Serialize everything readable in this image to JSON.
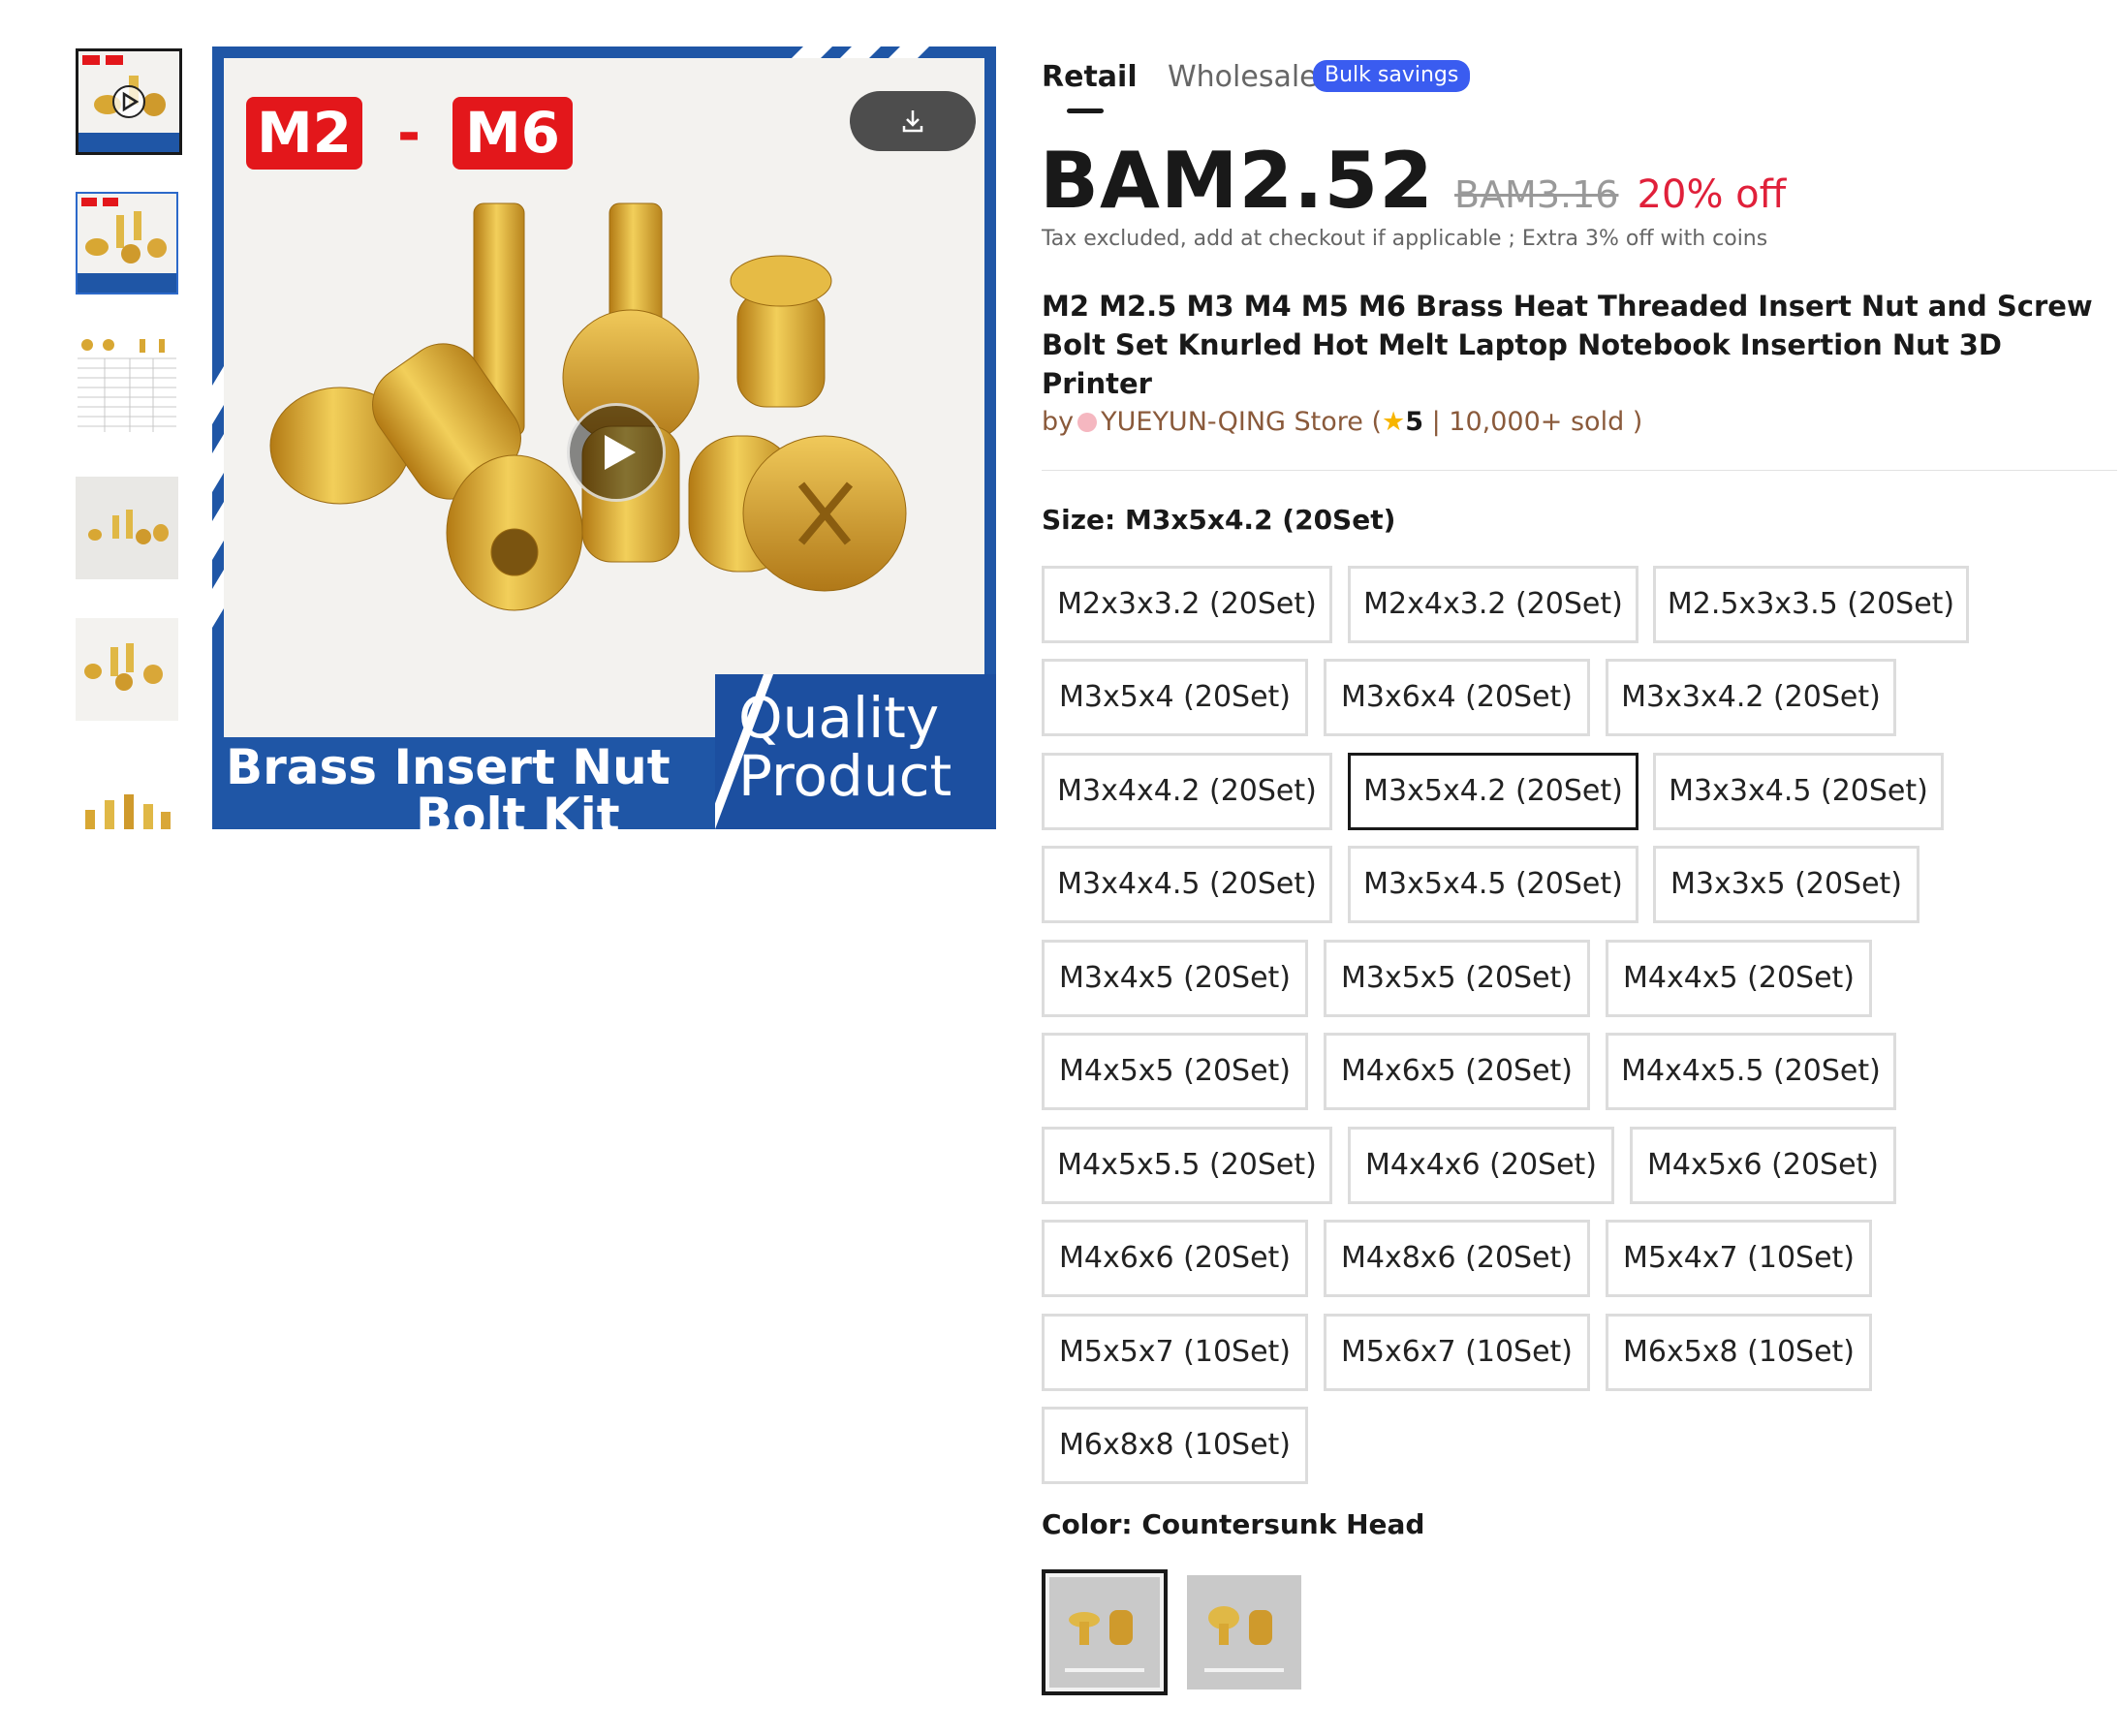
{
  "gallery": {
    "thumbnails": [
      {
        "label": "M2 M6 Brass Insert Nut Bolt Kit video",
        "has_play": true
      },
      {
        "label": "M2 M6 Brass Insert Nut Bolt Kit"
      },
      {
        "label": "size chart"
      },
      {
        "label": "brass inserts photo"
      },
      {
        "label": "brass inserts photo 2"
      },
      {
        "label": "brass inserts photo 3"
      }
    ],
    "main_image": {
      "badge_left": "M2",
      "badge_dash": "-",
      "badge_right": "M6",
      "banner_line1": "Brass Insert Nut",
      "banner_line2": "Bolt Kit",
      "quality_line1": "Quality",
      "quality_line2": "Product"
    }
  },
  "tabs": {
    "retail": "Retail",
    "wholesale": "Wholesale",
    "bulk_badge": "Bulk savings"
  },
  "price": {
    "current": "BAM2.52",
    "original": "BAM3.16",
    "discount": "20% off"
  },
  "tax_note": "Tax excluded, add at checkout if applicable ; Extra 3% off with coins",
  "title": "M2 M2.5 M3 M4 M5 M6 Brass Heat Threaded Insert Nut and Screw Bolt Set Knurled Hot Melt Laptop Notebook Insertion Nut 3D Printer",
  "store": {
    "by": "by",
    "name": "YUEYUN-QING Store",
    "open_paren": " (",
    "star": "★",
    "rating": "5",
    "sold": " | 10,000+ sold )"
  },
  "size": {
    "label": "Size: M3x5x4.2 (20Set)",
    "options": [
      "M2x3x3.2 (20Set)",
      "M2x4x3.2 (20Set)",
      "M2.5x3x3.5 (20Set)",
      "M3x5x4 (20Set)",
      "M3x6x4 (20Set)",
      "M3x3x4.2 (20Set)",
      "M3x4x4.2 (20Set)",
      "M3x5x4.2 (20Set)",
      "M3x3x4.5 (20Set)",
      "M3x4x4.5 (20Set)",
      "M3x5x4.5 (20Set)",
      "M3x3x5 (20Set)",
      "M3x4x5 (20Set)",
      "M3x5x5 (20Set)",
      "M4x4x5 (20Set)",
      "M4x5x5 (20Set)",
      "M4x6x5 (20Set)",
      "M4x4x5.5 (20Set)",
      "M4x5x5.5 (20Set)",
      "M4x4x6 (20Set)",
      "M4x5x6 (20Set)",
      "M4x6x6 (20Set)",
      "M4x8x6 (20Set)",
      "M5x4x7 (10Set)",
      "M5x5x7 (10Set)",
      "M5x6x7 (10Set)",
      "M6x5x8 (10Set)",
      "M6x8x8 (10Set)"
    ],
    "selected": "M3x5x4.2 (20Set)"
  },
  "color": {
    "label": "Color: Countersunk Head",
    "swatches": [
      {
        "caption": "1 SET = 1 BOLT + 1 INSERT NUT",
        "selected": true
      },
      {
        "caption": "1 SET = 1 BOLT + 1 INSERT NUT",
        "selected": false
      }
    ]
  },
  "colors": {
    "accent_blue": "#3a5cf0",
    "discount_red": "#e0203a",
    "store_brown": "#8a5a3b",
    "banner_blue": "#1f56a6"
  }
}
